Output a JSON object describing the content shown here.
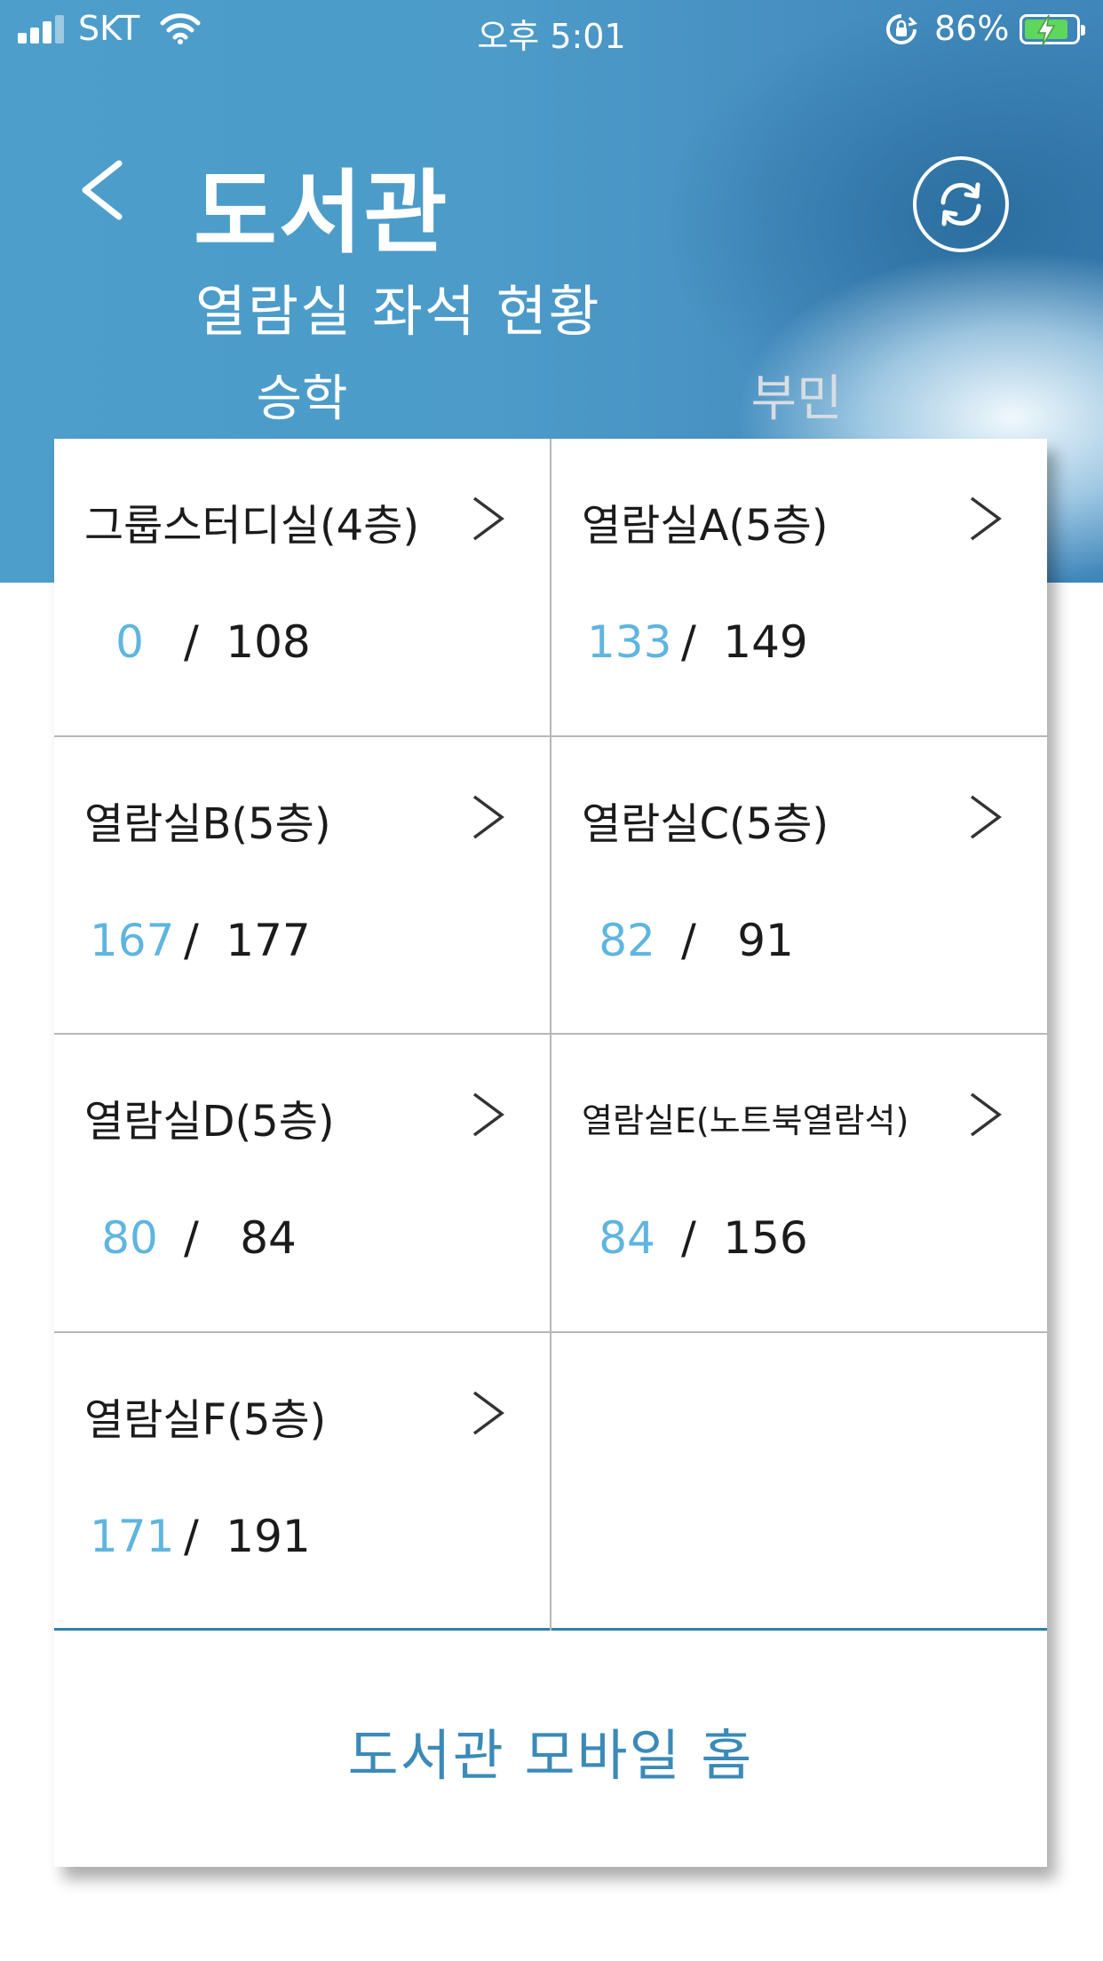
{
  "status_bar": {
    "carrier": "SKT",
    "time": "오후 5:01",
    "battery_percent": "86%",
    "battery_level": 0.86,
    "icons": [
      "signal-icon",
      "wifi-icon",
      "rotation-lock-icon",
      "battery-charging-icon"
    ]
  },
  "header": {
    "back_icon": "chevron-left-icon",
    "title": "도서관",
    "subtitle": "열람실 좌석 현황",
    "refresh_icon": "refresh-icon"
  },
  "tabs": [
    {
      "label": "승학",
      "selected": true
    },
    {
      "label": "부민",
      "selected": false
    }
  ],
  "rooms": [
    {
      "name": "그룹스터디실(4층)",
      "available": "0",
      "total": "108"
    },
    {
      "name": "열람실A(5층)",
      "available": "133",
      "total": "149"
    },
    {
      "name": "열람실B(5층)",
      "available": "167",
      "total": "177"
    },
    {
      "name": "열람실C(5층)",
      "available": "82",
      "total": "91"
    },
    {
      "name": "열람실D(5층)",
      "available": "80",
      "total": "84"
    },
    {
      "name": "열람실E(노트북열람석)",
      "available": "84",
      "total": "156"
    },
    {
      "name": "열람실F(5층)",
      "available": "171",
      "total": "191"
    }
  ],
  "separator": "/",
  "footer": {
    "home_label": "도서관 모바일 홈"
  },
  "colors": {
    "header_blue": "#4c9bc9",
    "available_blue": "#5fb5df",
    "footer_text": "#3b8ab8",
    "divider": "#2f7fab"
  }
}
